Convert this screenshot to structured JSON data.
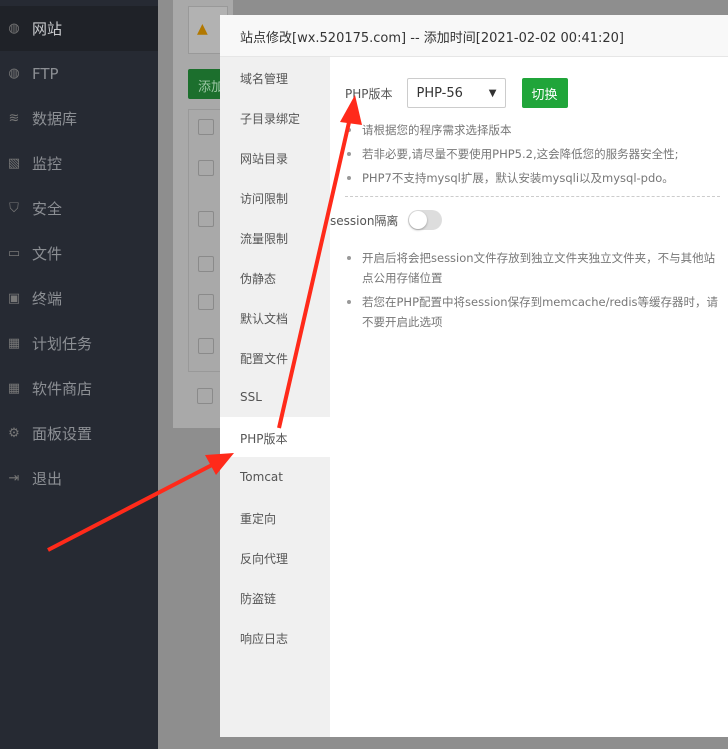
{
  "sidebar": {
    "items": [
      {
        "label": "网站",
        "icon": "globe-icon"
      },
      {
        "label": "FTP",
        "icon": "ftp-icon"
      },
      {
        "label": "数据库",
        "icon": "database-icon"
      },
      {
        "label": "监控",
        "icon": "monitor-icon"
      },
      {
        "label": "安全",
        "icon": "shield-icon"
      },
      {
        "label": "文件",
        "icon": "folder-icon"
      },
      {
        "label": "终端",
        "icon": "terminal-icon"
      },
      {
        "label": "计划任务",
        "icon": "calendar-icon"
      },
      {
        "label": "软件商店",
        "icon": "grid-icon"
      },
      {
        "label": "面板设置",
        "icon": "gear-icon"
      },
      {
        "label": "退出",
        "icon": "logout-icon"
      }
    ]
  },
  "background": {
    "add_button": "添加"
  },
  "modal": {
    "title": "站点修改[wx.520175.com] -- 添加时间[2021-02-02 00:41:20]",
    "menu": [
      "域名管理",
      "子目录绑定",
      "网站目录",
      "访问限制",
      "流量限制",
      "伪静态",
      "默认文档",
      "配置文件",
      "SSL",
      "PHP版本",
      "Tomcat",
      "重定向",
      "反向代理",
      "防盗链",
      "响应日志"
    ],
    "active_menu": "PHP版本",
    "php_label": "PHP版本",
    "php_select": "PHP-56",
    "switch_button": "切换",
    "tips": [
      "请根据您的程序需求选择版本",
      "若非必要,请尽量不要使用PHP5.2,这会降低您的服务器安全性;",
      "PHP7不支持mysql扩展，默认安装mysqli以及mysql-pdo。"
    ],
    "session_label": "session隔离",
    "session_enabled": false,
    "session_tips": [
      "开启后将会把session文件存放到独立文件夹独立文件夹，不与其他站点公用存储位置",
      "若您在PHP配置中将session保存到memcache/redis等缓存器时，请不要开启此选项"
    ]
  },
  "colors": {
    "accent": "#20a53a",
    "arrow": "#ff2a1a"
  }
}
